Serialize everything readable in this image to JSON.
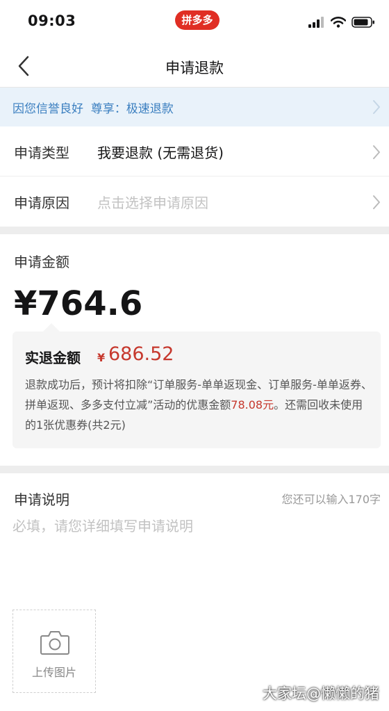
{
  "status_bar": {
    "time": "09:03",
    "app_badge": "拼多多"
  },
  "nav": {
    "title": "申请退款"
  },
  "notice": {
    "text": "因您信誉良好  尊享：极速退款"
  },
  "form": {
    "type_label": "申请类型",
    "type_value": "我要退款 (无需退货)",
    "reason_label": "申请原因",
    "reason_placeholder": "点击选择申请原因"
  },
  "amount": {
    "label": "申请金额",
    "value": "¥764.6",
    "refund_title": "实退金额",
    "refund_currency": "¥",
    "refund_value": "686.52",
    "desc_before": "退款成功后，预计将扣除“订单服务-单单返现金、订单服务-单单返券、拼单返现、多多支付立减”活动的优惠金额",
    "desc_highlight": "78.08元",
    "desc_after": "。还需回收未使用的1张优惠券(共2元)"
  },
  "description": {
    "label": "申请说明",
    "counter": "您还可以输入170字",
    "placeholder": "必填，请您详细填写申请说明",
    "upload_label": "上传图片"
  },
  "watermark": "大家坛@懒懒的猪",
  "colors": {
    "accent_red": "#c6382d",
    "notice_blue": "#3b7fc0",
    "badge_red": "#e02e24"
  }
}
